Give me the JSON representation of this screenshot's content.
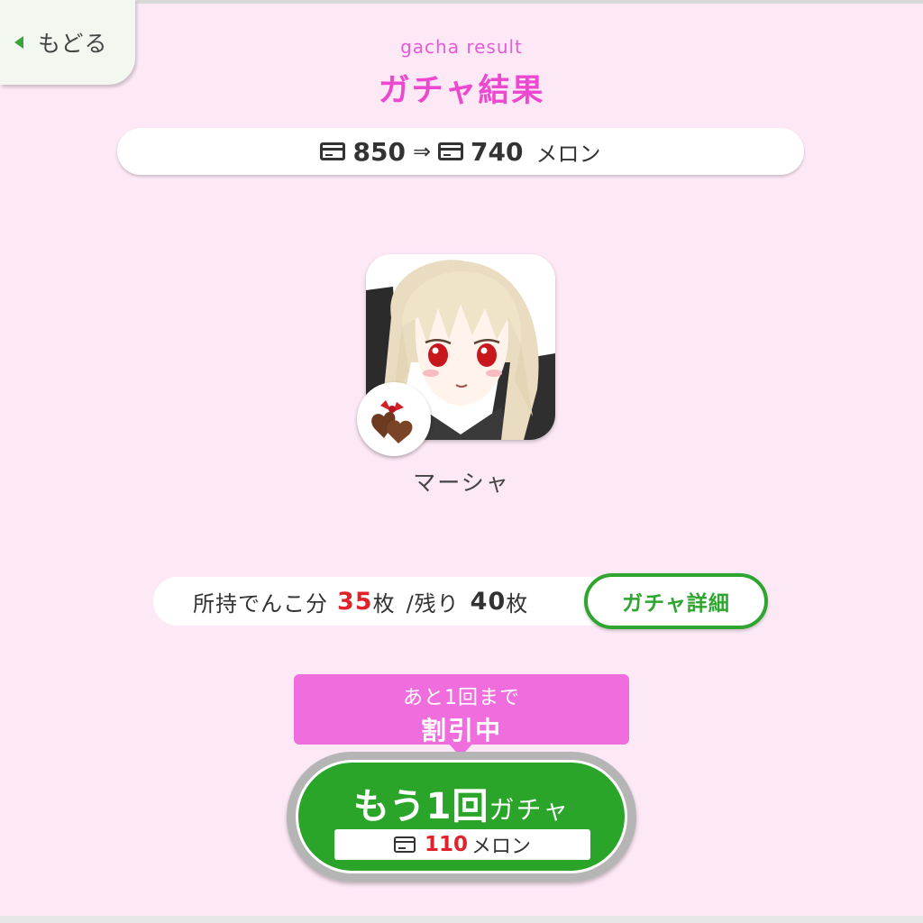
{
  "nav": {
    "back_label": "もどる"
  },
  "header": {
    "subtitle": "gacha result",
    "title": "ガチャ結果"
  },
  "balance": {
    "before": "850",
    "arrow": "⇒",
    "after": "740",
    "unit": "メロン",
    "icon": "card-icon"
  },
  "result": {
    "character_name": "マーシャ",
    "badge_icon": "chocolate-icon"
  },
  "progress": {
    "owned_label": "所持でんこ分",
    "owned_count": "35",
    "owned_unit": "枚",
    "remaining_label": "/残り",
    "remaining_count": "40",
    "remaining_unit": "枚"
  },
  "detail_button": "ガチャ詳細",
  "discount": {
    "line1": "あと1回まで",
    "line2": "割引中"
  },
  "again_button": {
    "main": "もう1回",
    "sub": "ガチャ",
    "price": "110",
    "price_unit": "メロン"
  },
  "colors": {
    "background": "#fde9f6",
    "accent_pink": "#ec49d0",
    "green": "#2aa52a",
    "red": "#e0232b"
  }
}
